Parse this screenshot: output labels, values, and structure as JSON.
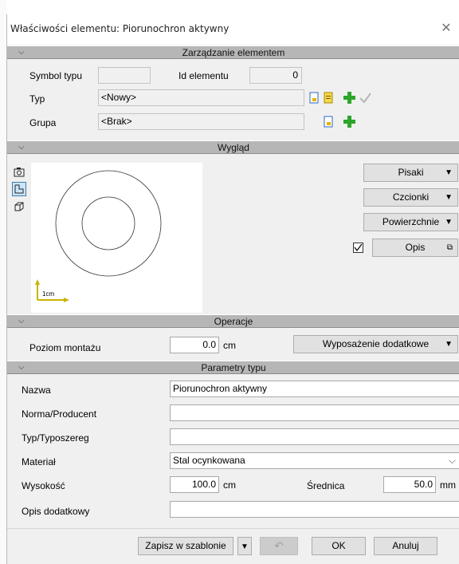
{
  "window": {
    "title": "Właściwości elementu: Piorunochron aktywny"
  },
  "sections": {
    "management": "Zarządzanie elementem",
    "appearance": "Wygląd",
    "operations": "Operacje",
    "type_params": "Parametry typu"
  },
  "management": {
    "symbol_label": "Symbol typu",
    "symbol_value": "",
    "id_label": "Id elementu",
    "id_value": "0",
    "type_label": "Typ",
    "type_value": "<Nowy>",
    "group_label": "Grupa",
    "group_value": "<Brak>"
  },
  "appearance": {
    "scale_label": "1cm",
    "pens_label": "Pisaki",
    "fonts_label": "Czcionki",
    "surfaces_label": "Powierzchnie",
    "description_label": "Opis",
    "description_checked": true
  },
  "operations": {
    "mount_level_label": "Poziom montażu",
    "mount_level_value": "0.0",
    "mount_level_unit": "cm",
    "extra_equipment_label": "Wyposażenie dodatkowe"
  },
  "type_params": {
    "name_label": "Nazwa",
    "name_value": "Piorunochron aktywny",
    "norm_label": "Norma/Producent",
    "norm_value": "",
    "series_label": "Typ/Typoszereg",
    "series_value": "",
    "material_label": "Materiał",
    "material_value": "Stal ocynkowana",
    "height_label": "Wysokość",
    "height_value": "100.0",
    "height_unit": "cm",
    "diameter_label": "Średnica",
    "diameter_value": "50.0",
    "diameter_unit": "mm",
    "extra_desc_label": "Opis dodatkowy",
    "extra_desc_value": ""
  },
  "footer": {
    "save_template_label": "Zapisz w szablonie",
    "ok_label": "OK",
    "cancel_label": "Anuluj"
  },
  "colors": {
    "section_header": "#b6b6b6",
    "dialog_bg": "#f0f0f0",
    "plus_green": "#2aa52a",
    "scale_yellow": "#c8b400"
  }
}
